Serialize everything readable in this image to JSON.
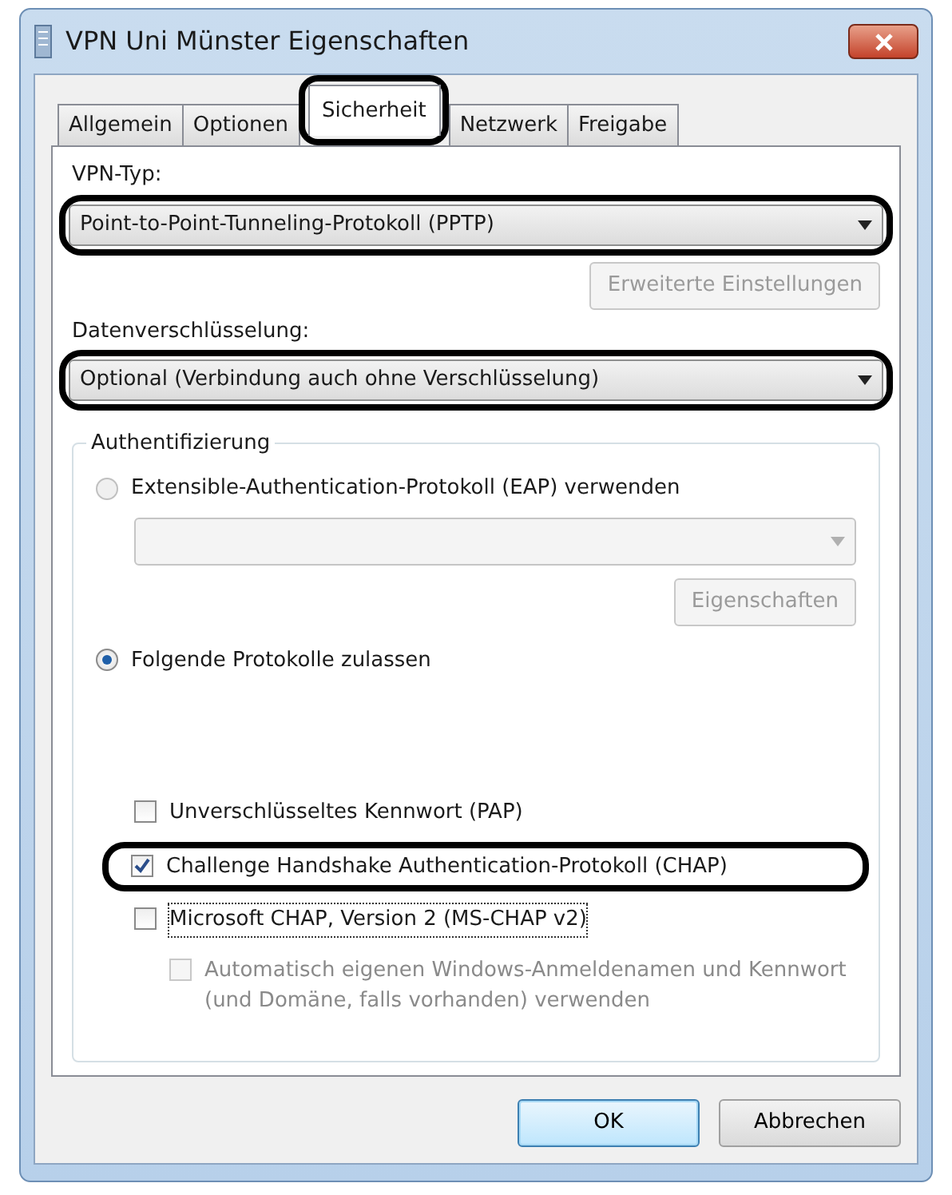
{
  "window": {
    "title": "VPN Uni Münster Eigenschaften"
  },
  "tabs": [
    {
      "label": "Allgemein",
      "selected": false,
      "highlighted": false
    },
    {
      "label": "Optionen",
      "selected": false,
      "highlighted": false
    },
    {
      "label": "Sicherheit",
      "selected": true,
      "highlighted": true
    },
    {
      "label": "Netzwerk",
      "selected": false,
      "highlighted": false
    },
    {
      "label": "Freigabe",
      "selected": false,
      "highlighted": false
    }
  ],
  "vpn_type": {
    "label": "VPN-Typ:",
    "value": "Point-to-Point-Tunneling-Protokoll (PPTP)",
    "highlighted": true
  },
  "advanced_button": {
    "label": "Erweiterte Einstellungen",
    "disabled": true
  },
  "encryption": {
    "label": "Datenverschlüsselung:",
    "value": "Optional (Verbindung auch ohne Verschlüsselung)",
    "highlighted": true
  },
  "authentication": {
    "title": "Authentifizierung",
    "options": [
      {
        "label": "Extensible-Authentication-Protokoll (EAP) verwenden",
        "selected": false,
        "disabled": true
      },
      {
        "label": "Folgende Protokolle zulassen",
        "selected": true,
        "disabled": false
      }
    ],
    "eap_select": {
      "disabled": true
    },
    "properties_button": {
      "label": "Eigenschaften",
      "disabled": true
    },
    "protocols": [
      {
        "label": "Unverschlüsseltes Kennwort (PAP)",
        "checked": false,
        "disabled": false,
        "focused": false,
        "highlighted": false
      },
      {
        "label": "Challenge Handshake Authentication-Protokoll (CHAP)",
        "checked": true,
        "disabled": false,
        "focused": false,
        "highlighted": true
      },
      {
        "label": "Microsoft CHAP, Version 2 (MS-CHAP v2)",
        "checked": false,
        "disabled": false,
        "focused": true,
        "highlighted": false,
        "children": [
          {
            "label": "Automatisch eigenen Windows-Anmeldenamen und Kennwort (und Domäne, falls vorhanden) verwenden",
            "checked": false,
            "disabled": true,
            "focused": false,
            "highlighted": false
          }
        ]
      }
    ]
  },
  "buttons": [
    {
      "label": "OK",
      "default": true
    },
    {
      "label": "Abbrechen",
      "default": false
    }
  ]
}
